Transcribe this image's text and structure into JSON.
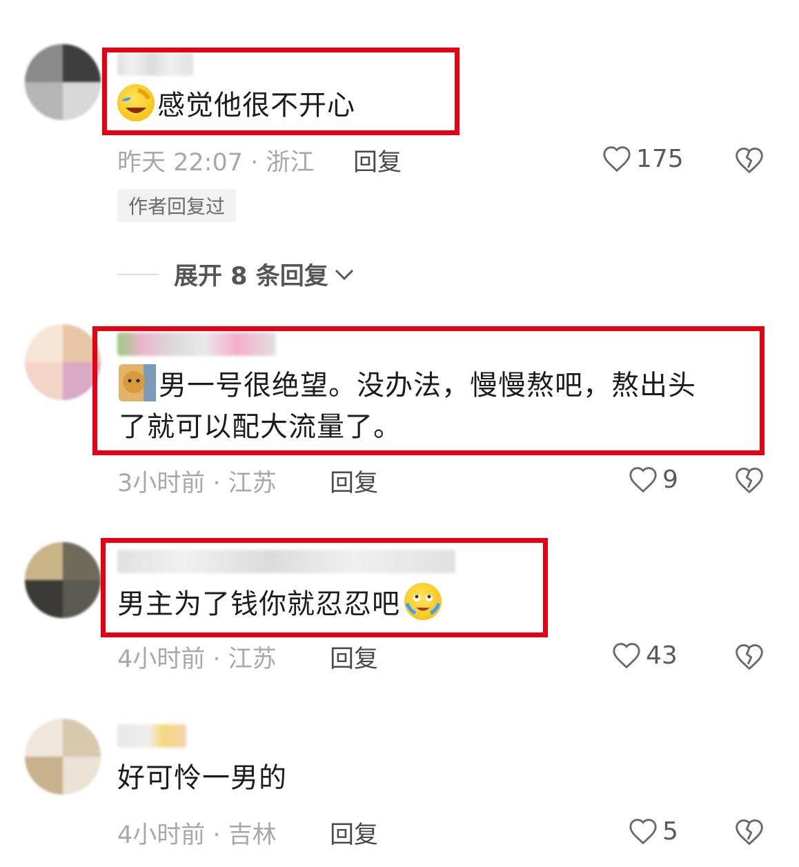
{
  "comments": [
    {
      "text_lines": [
        "感觉他很不开心"
      ],
      "emoji_icon": "face-palm-laughing-icon",
      "time": "昨天 22:07 · 浙江",
      "reply": "回复",
      "likes": "175",
      "badge": "作者回复过",
      "expand": "展开 8 条回复"
    },
    {
      "text_lines": [
        "男一号很绝望。没办法，慢慢熬吧，熬出头",
        "了就可以配大流量了。"
      ],
      "emoji_icon": "sad-cat-icon",
      "time": "3小时前 · 江苏",
      "reply": "回复",
      "likes": "9"
    },
    {
      "text_lines": [
        "男主为了钱你就忍忍吧"
      ],
      "emoji_icon": "crying-face-icon",
      "time": "4小时前 · 江苏",
      "reply": "回复",
      "likes": "43"
    },
    {
      "text_lines": [
        "好可怜一男的"
      ],
      "time": "4小时前 · 吉林",
      "reply": "回复",
      "likes": "5"
    }
  ],
  "colors": {
    "highlight": "#e60012",
    "meta_text": "#a8a8a8"
  }
}
